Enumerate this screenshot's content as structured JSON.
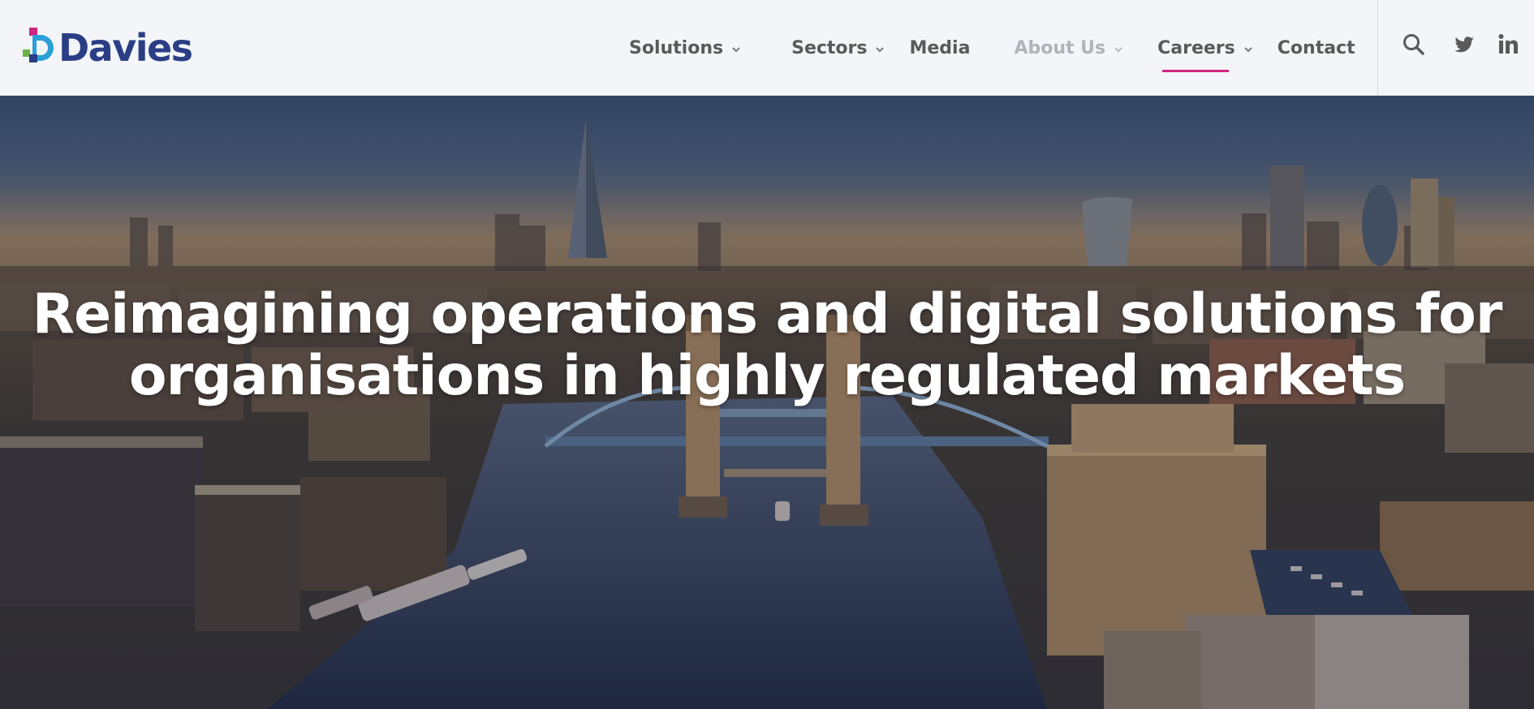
{
  "brand": {
    "name": "Davies",
    "colors": {
      "primary": "#2a3e86",
      "accent": "#d0267f",
      "teal": "#2aa0d6",
      "green": "#6ab445"
    }
  },
  "nav": {
    "items": [
      {
        "label": "Solutions",
        "has_dropdown": true,
        "state": "default"
      },
      {
        "label": "Sectors",
        "has_dropdown": true,
        "state": "default"
      },
      {
        "label": "Media",
        "has_dropdown": false,
        "state": "default"
      },
      {
        "label": "About Us",
        "has_dropdown": true,
        "state": "muted"
      },
      {
        "label": "Careers",
        "has_dropdown": true,
        "state": "active"
      },
      {
        "label": "Contact",
        "has_dropdown": false,
        "state": "default"
      }
    ]
  },
  "header_icons": [
    "search-icon",
    "twitter-icon",
    "linkedin-icon"
  ],
  "hero": {
    "headline_line1": "Reimagining operations and digital solutions for",
    "headline_line2": "organisations in highly regulated markets"
  }
}
